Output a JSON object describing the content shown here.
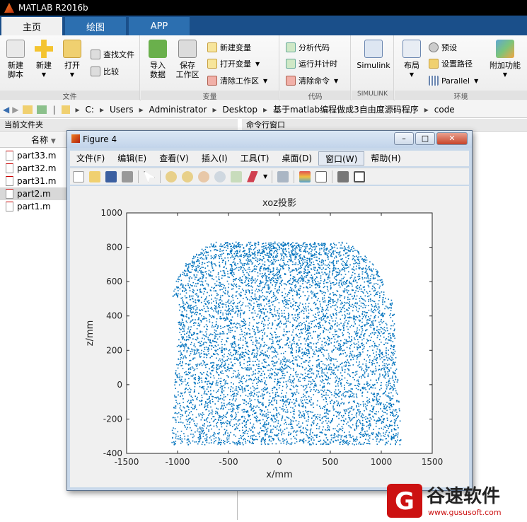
{
  "app": {
    "title": "MATLAB R2016b"
  },
  "tabs": [
    {
      "label": "主页",
      "active": true
    },
    {
      "label": "绘图",
      "active": false
    },
    {
      "label": "APP",
      "active": false
    }
  ],
  "ribbon": {
    "groups": {
      "file": "文件",
      "variable": "变量",
      "code": "代码",
      "simulink": "SIMULINK",
      "env": "环境"
    },
    "new_script": "新建\n脚本",
    "new": "新建",
    "open": "打开",
    "find_files": "查找文件",
    "compare": "比较",
    "import_data": "导入\n数据",
    "save_workspace": "保存\n工作区",
    "new_variable": "新建变量",
    "open_variable": "打开变量",
    "clear_workspace": "清除工作区",
    "analyze_code": "分析代码",
    "run_time": "运行并计时",
    "clear_commands": "清除命令",
    "simulink": "Simulink",
    "layout": "布局",
    "preferences": "预设",
    "set_path": "设置路径",
    "parallel": "Parallel",
    "addons": "附加功能"
  },
  "address": {
    "segments": [
      "C:",
      "Users",
      "Administrator",
      "Desktop",
      "基于matlab编程做成3自由度源码程序",
      "code"
    ]
  },
  "panels": {
    "current_folder": "当前文件夹",
    "command_window": "命令行窗口",
    "name_column": "名称"
  },
  "files": [
    {
      "name": "part33.m",
      "selected": false
    },
    {
      "name": "part32.m",
      "selected": false
    },
    {
      "name": "part31.m",
      "selected": false
    },
    {
      "name": "part2.m",
      "selected": true
    },
    {
      "name": "part1.m",
      "selected": false
    }
  ],
  "figure": {
    "title": "Figure 4",
    "menu": [
      "文件(F)",
      "编辑(E)",
      "查看(V)",
      "插入(I)",
      "工具(T)",
      "桌面(D)",
      "窗口(W)",
      "帮助(H)"
    ],
    "menu_highlight_index": 6,
    "buttons": {
      "minimize": "–",
      "maximize": "□",
      "close": "✕"
    }
  },
  "chart_data": {
    "type": "scatter",
    "title": "xoz投影",
    "xlabel": "x/mm",
    "ylabel": "z/mm",
    "xlim": [
      -1500,
      1500
    ],
    "ylim": [
      -400,
      1000
    ],
    "xticks": [
      -1500,
      -1000,
      -500,
      0,
      500,
      1000,
      1500
    ],
    "yticks": [
      -400,
      -200,
      0,
      200,
      400,
      600,
      800,
      1000
    ],
    "color": "#0072BD",
    "num_points": 7000,
    "series": [
      {
        "values": "dense cloud of points filling a dome-shaped region: x from about -1000 to 1150, z from about -350 to 830; top boundary narrows to x≈-600..+600 near z=800"
      }
    ]
  },
  "watermark": {
    "text": "谷速软件",
    "url": "www.gususoft.com",
    "color": "#cc1111"
  }
}
